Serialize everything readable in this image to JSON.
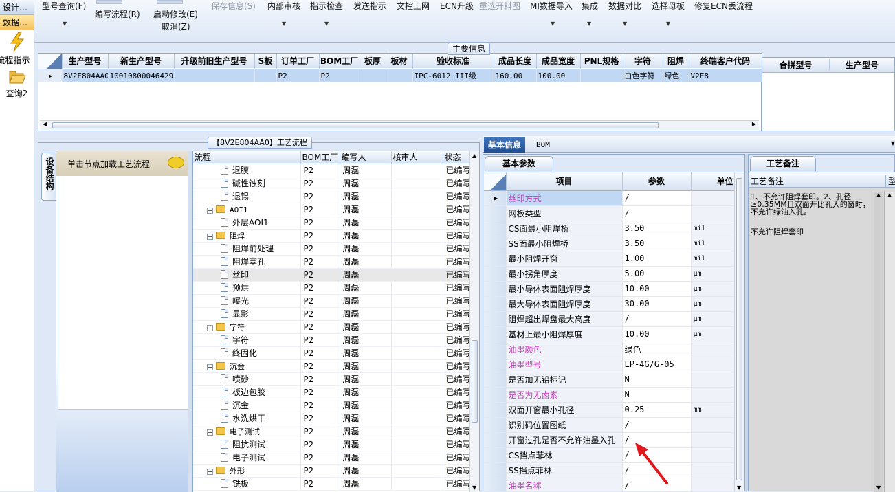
{
  "left_nav": {
    "header1": "设计…",
    "header2": "数据…",
    "items": [
      {
        "label": "流程指示",
        "icon": "lightning-icon"
      },
      {
        "label": "查询2",
        "icon": "folder-open-icon"
      }
    ]
  },
  "toolbar": {
    "buttons": [
      {
        "label": "型号查询(F)",
        "disabled": false
      },
      {
        "label": "编写流程(R)",
        "disabled": false
      },
      {
        "label": "启动修改(E)",
        "disabled": false
      },
      {
        "label": "取消(Z)",
        "disabled": false
      },
      {
        "label": "保存信息(S)",
        "disabled": true
      },
      {
        "label": "内部审核",
        "disabled": false
      },
      {
        "label": "指示检查",
        "disabled": false
      },
      {
        "label": "发送指示",
        "disabled": false
      },
      {
        "label": "文控上网",
        "disabled": false
      },
      {
        "label": "ECN升级",
        "disabled": false
      },
      {
        "label": "重选开料图",
        "disabled": true
      },
      {
        "label": "MI数据导入",
        "disabled": false
      },
      {
        "label": "集成",
        "disabled": false
      },
      {
        "label": "数据对比",
        "disabled": false
      },
      {
        "label": "选择母板",
        "disabled": false
      },
      {
        "label": "修复ECN丢流程",
        "disabled": false
      }
    ]
  },
  "main_info": {
    "title": "主要信息",
    "columns": [
      "生产型号",
      "新生产型号",
      "升级前旧生产型号",
      "S板",
      "订单工厂",
      "BOM工厂",
      "板厚",
      "板材",
      "验收标准",
      "成品长度",
      "成品宽度",
      "PNL规格",
      "字符",
      "阻焊",
      "终端客户代码"
    ],
    "rows": [
      [
        "8V2E804AA0",
        "10010800046429",
        "",
        "",
        "P2",
        "P2",
        "",
        "",
        "IPC-6012 III级",
        "160.00",
        "100.00",
        "",
        "白色字符",
        "绿色",
        "V2E8"
      ]
    ]
  },
  "combine": {
    "columns": [
      "合拼型号",
      "生产型号"
    ]
  },
  "process": {
    "title": "【8V2E804AA0】工艺流程",
    "side_tab": "设备结构",
    "load_hint": "单击节点加载工艺流程",
    "columns": [
      "流程",
      "BOM工厂",
      "编写人",
      "核审人",
      "状态"
    ],
    "rows": [
      {
        "name": "退膜",
        "type": "doc",
        "level": 2,
        "factory": "P2",
        "writer": "周磊",
        "reviewer": "",
        "status": "已编写"
      },
      {
        "name": "碱性蚀刻",
        "type": "doc",
        "level": 2,
        "factory": "P2",
        "writer": "周磊",
        "reviewer": "",
        "status": "已编写"
      },
      {
        "name": "退锡",
        "type": "doc",
        "level": 2,
        "factory": "P2",
        "writer": "周磊",
        "reviewer": "",
        "status": "已编写"
      },
      {
        "name": "AOI1",
        "type": "folder",
        "level": 1,
        "factory": "P2",
        "writer": "周磊",
        "reviewer": "",
        "status": "已编写"
      },
      {
        "name": "外层AOI1",
        "type": "doc",
        "level": 2,
        "factory": "P2",
        "writer": "周磊",
        "reviewer": "",
        "status": "已编写"
      },
      {
        "name": "阻焊",
        "type": "folder",
        "level": 1,
        "factory": "P2",
        "writer": "周磊",
        "reviewer": "",
        "status": "已编写"
      },
      {
        "name": "阻焊前处理",
        "type": "doc",
        "level": 2,
        "factory": "P2",
        "writer": "周磊",
        "reviewer": "",
        "status": "已编写"
      },
      {
        "name": "阻焊塞孔",
        "type": "doc",
        "level": 2,
        "factory": "P2",
        "writer": "周磊",
        "reviewer": "",
        "status": "已编写"
      },
      {
        "name": "丝印",
        "type": "doc",
        "level": 2,
        "factory": "P2",
        "writer": "周磊",
        "reviewer": "",
        "status": "已编写",
        "selected": true
      },
      {
        "name": "预烘",
        "type": "doc",
        "level": 2,
        "factory": "P2",
        "writer": "周磊",
        "reviewer": "",
        "status": "已编写"
      },
      {
        "name": "曝光",
        "type": "doc",
        "level": 2,
        "factory": "P2",
        "writer": "周磊",
        "reviewer": "",
        "status": "已编写"
      },
      {
        "name": "显影",
        "type": "doc",
        "level": 2,
        "factory": "P2",
        "writer": "周磊",
        "reviewer": "",
        "status": "已编写"
      },
      {
        "name": "字符",
        "type": "folder",
        "level": 1,
        "factory": "P2",
        "writer": "周磊",
        "reviewer": "",
        "status": "已编写"
      },
      {
        "name": "字符",
        "type": "doc",
        "level": 2,
        "factory": "P2",
        "writer": "周磊",
        "reviewer": "",
        "status": "已编写"
      },
      {
        "name": "终固化",
        "type": "doc",
        "level": 2,
        "factory": "P2",
        "writer": "周磊",
        "reviewer": "",
        "status": "已编写"
      },
      {
        "name": "沉金",
        "type": "folder",
        "level": 1,
        "factory": "P2",
        "writer": "周磊",
        "reviewer": "",
        "status": "已编写"
      },
      {
        "name": "喷砂",
        "type": "doc",
        "level": 2,
        "factory": "P2",
        "writer": "周磊",
        "reviewer": "",
        "status": "已编写"
      },
      {
        "name": "板边包胶",
        "type": "doc",
        "level": 2,
        "factory": "P2",
        "writer": "周磊",
        "reviewer": "",
        "status": "已编写"
      },
      {
        "name": "沉金",
        "type": "doc",
        "level": 2,
        "factory": "P2",
        "writer": "周磊",
        "reviewer": "",
        "status": "已编写"
      },
      {
        "name": "水洗烘干",
        "type": "doc",
        "level": 2,
        "factory": "P2",
        "writer": "周磊",
        "reviewer": "",
        "status": "已编写"
      },
      {
        "name": "电子测试",
        "type": "folder",
        "level": 1,
        "factory": "P2",
        "writer": "周磊",
        "reviewer": "",
        "status": "已编写"
      },
      {
        "name": "阻抗测试",
        "type": "doc",
        "level": 2,
        "factory": "P2",
        "writer": "周磊",
        "reviewer": "",
        "status": "已编写"
      },
      {
        "name": "电子测试",
        "type": "doc",
        "level": 2,
        "factory": "P2",
        "writer": "周磊",
        "reviewer": "",
        "status": "已编写"
      },
      {
        "name": "外形",
        "type": "folder",
        "level": 1,
        "factory": "P2",
        "writer": "周磊",
        "reviewer": "",
        "status": "已编写"
      },
      {
        "name": "铣板",
        "type": "doc",
        "level": 2,
        "factory": "P2",
        "writer": "周磊",
        "reviewer": "",
        "status": "已编写"
      }
    ]
  },
  "basic": {
    "tab_active": "基本信息",
    "tab_other": "BOM",
    "subtab": "基本参数",
    "remarks_tab": "工艺备注",
    "columns": [
      "项目",
      "参数",
      "单位"
    ],
    "rows": [
      {
        "item": "丝印方式",
        "value": "/",
        "unit": "",
        "pink": true,
        "selected": true
      },
      {
        "item": "网板类型",
        "value": "/",
        "unit": "",
        "pink": false
      },
      {
        "item": "CS面最小阻焊桥",
        "value": "3.50",
        "unit": "mil",
        "pink": false
      },
      {
        "item": "SS面最小阻焊桥",
        "value": "3.50",
        "unit": "mil",
        "pink": false
      },
      {
        "item": "最小阻焊开窗",
        "value": "1.00",
        "unit": "mil",
        "pink": false
      },
      {
        "item": "最小拐角厚度",
        "value": "5.00",
        "unit": "μm",
        "pink": false
      },
      {
        "item": "最小导体表面阻焊厚度",
        "value": "10.00",
        "unit": "μm",
        "pink": false
      },
      {
        "item": "最大导体表面阻焊厚度",
        "value": "30.00",
        "unit": "μm",
        "pink": false
      },
      {
        "item": "阻焊超出焊盘最大高度",
        "value": "/",
        "unit": "μm",
        "pink": false
      },
      {
        "item": "基材上最小阻焊厚度",
        "value": "10.00",
        "unit": "μm",
        "pink": false
      },
      {
        "item": "油墨颜色",
        "value": "绿色",
        "unit": "",
        "pink": true
      },
      {
        "item": "油墨型号",
        "value": "LP-4G/G-05",
        "unit": "",
        "pink": true
      },
      {
        "item": "是否加无铅标记",
        "value": "N",
        "unit": "",
        "pink": false
      },
      {
        "item": "是否为无卤素",
        "value": "N",
        "unit": "",
        "pink": true
      },
      {
        "item": "双面开窗最小孔径",
        "value": "0.25",
        "unit": "mm",
        "pink": false
      },
      {
        "item": "识别码位置图纸",
        "value": "/",
        "unit": "",
        "pink": false
      },
      {
        "item": "开窗过孔是否不允许油墨入孔",
        "value": "/",
        "unit": "",
        "pink": false
      },
      {
        "item": "CS挡点菲林",
        "value": "/",
        "unit": "",
        "pink": false
      },
      {
        "item": "SS挡点菲林",
        "value": "/",
        "unit": "",
        "pink": false
      },
      {
        "item": "油墨名称",
        "value": "/",
        "unit": "",
        "pink": true
      }
    ],
    "remarks": {
      "header": "工艺备注",
      "header2": "型",
      "line1": "1、不允许阻焊套印。2、孔径≥0.35MM且双面开比孔大的窗时，不允许绿油入孔。",
      "line2": "不允许阻焊套印"
    }
  },
  "colors": {
    "accent": "#1f5fa8",
    "pink": "#c63ab7",
    "selection": "#c1d8f4",
    "arrow": "#e0161d"
  }
}
